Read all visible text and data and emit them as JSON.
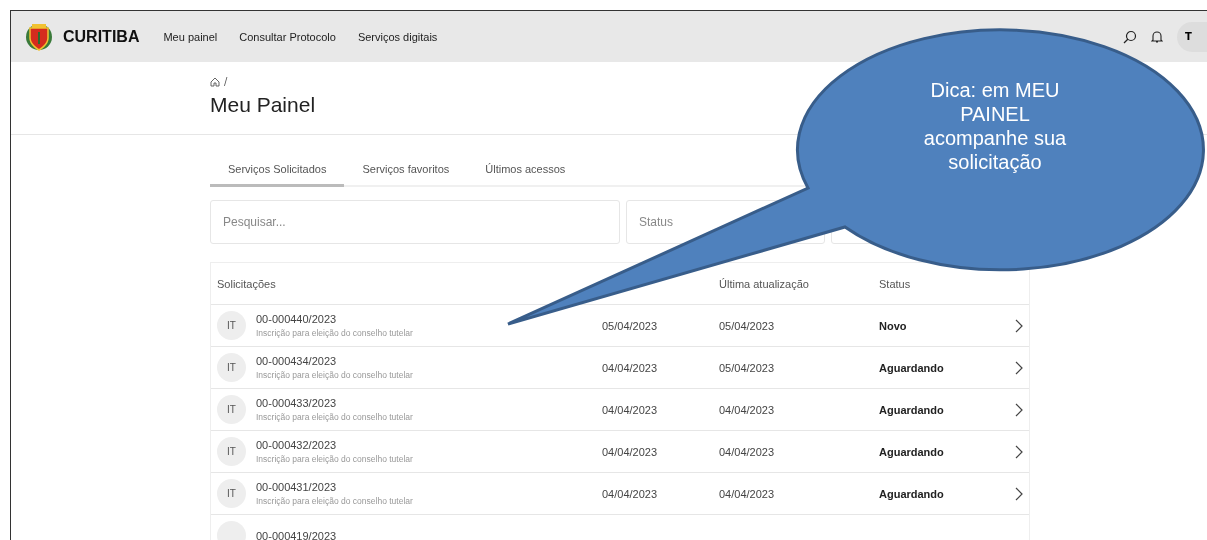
{
  "header": {
    "logo_text": "CURITIBA",
    "nav": [
      "Meu painel",
      "Consultar Protocolo",
      "Serviços digitais"
    ],
    "avatar": "T"
  },
  "breadcrumb": {
    "separator": "/"
  },
  "title": "Meu Painel",
  "tabs": [
    {
      "label": "Serviços Solicitados",
      "selected": true
    },
    {
      "label": "Serviços favoritos",
      "selected": false
    },
    {
      "label": "Últimos acessos",
      "selected": false
    }
  ],
  "search": {
    "placeholder": "Pesquisar..."
  },
  "status_filter": {
    "placeholder": "Status"
  },
  "table": {
    "columns": {
      "request": "Solicitações",
      "updated": "Última atualização",
      "status": "Status"
    },
    "rows": [
      {
        "initials": "IT",
        "protocol": "00-000440/2023",
        "description": "Inscrição para eleição do conselho tutelar",
        "date_1": "05/04/2023",
        "date_2": "05/04/2023",
        "status": "Novo"
      },
      {
        "initials": "IT",
        "protocol": "00-000434/2023",
        "description": "Inscrição para eleição do conselho tutelar",
        "date_1": "04/04/2023",
        "date_2": "05/04/2023",
        "status": "Aguardando"
      },
      {
        "initials": "IT",
        "protocol": "00-000433/2023",
        "description": "Inscrição para eleição do conselho tutelar",
        "date_1": "04/04/2023",
        "date_2": "04/04/2023",
        "status": "Aguardando"
      },
      {
        "initials": "IT",
        "protocol": "00-000432/2023",
        "description": "Inscrição para eleição do conselho tutelar",
        "date_1": "04/04/2023",
        "date_2": "04/04/2023",
        "status": "Aguardando"
      },
      {
        "initials": "IT",
        "protocol": "00-000431/2023",
        "description": "Inscrição para eleição do conselho tutelar",
        "date_1": "04/04/2023",
        "date_2": "04/04/2023",
        "status": "Aguardando"
      },
      {
        "protocol": "00-000419/2023"
      }
    ]
  },
  "callout": {
    "text": "Dica: em MEU\nPAINEL\nacompanhe sua\nsolicitação"
  }
}
